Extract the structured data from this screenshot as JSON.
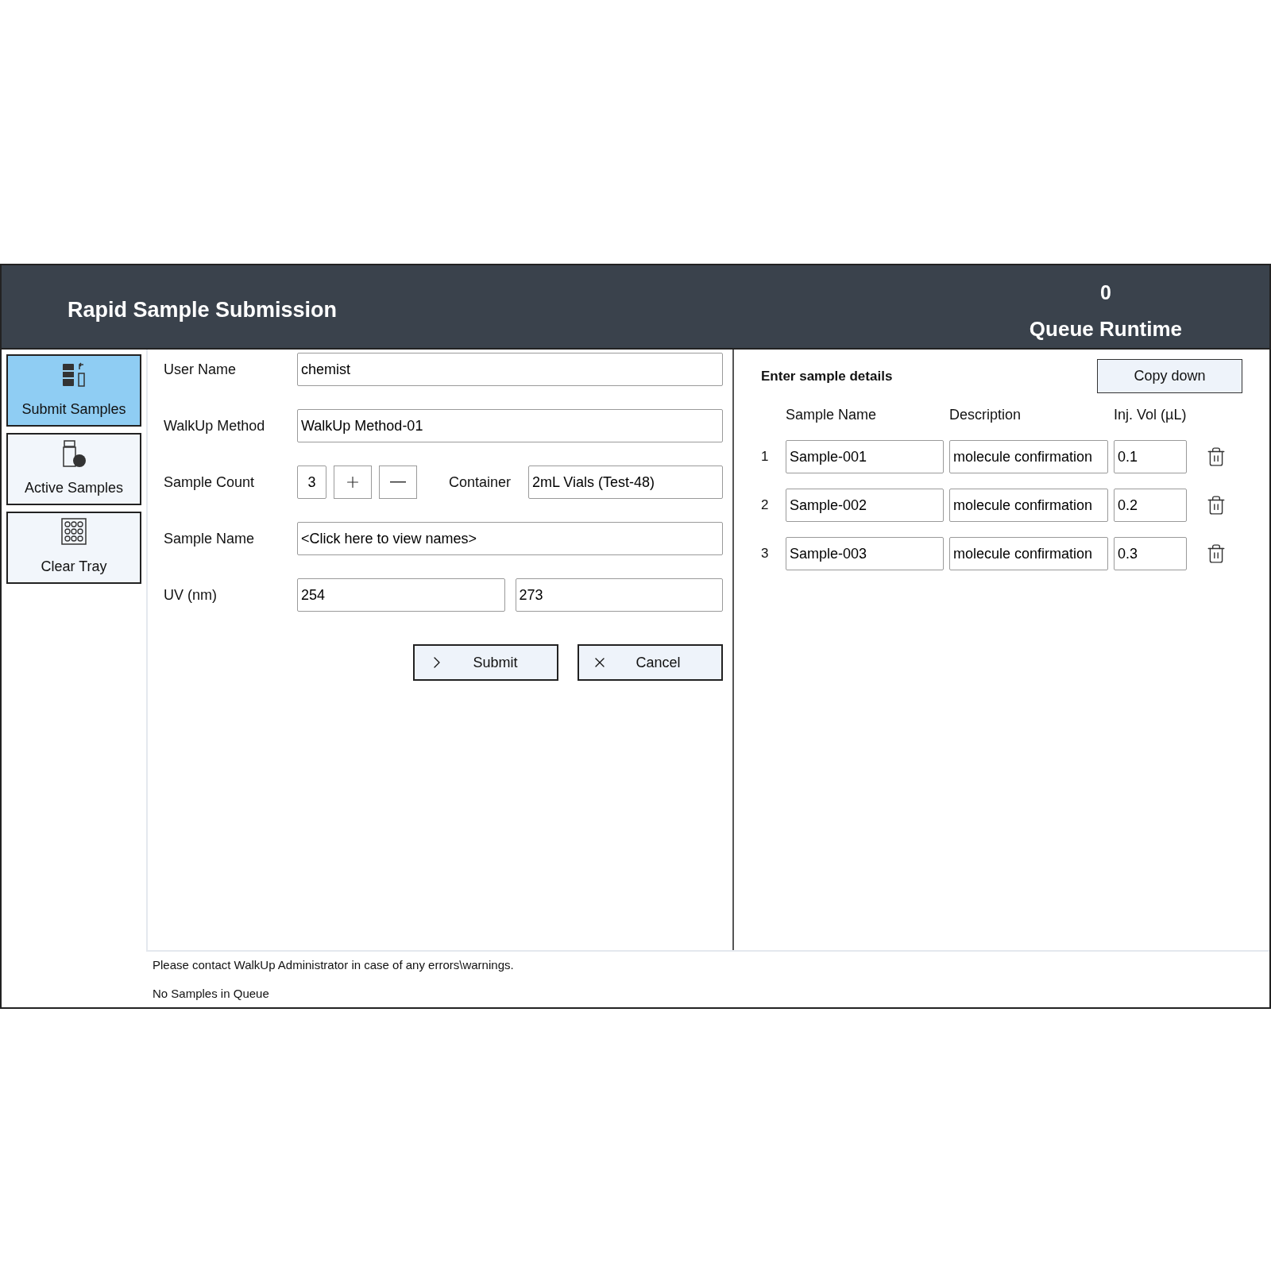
{
  "header": {
    "title": "Rapid Sample Submission",
    "queue_count": "0",
    "queue_label": "Queue Runtime"
  },
  "sidebar": {
    "items": [
      {
        "label": "Submit Samples",
        "selected": true,
        "kind": "bottles"
      },
      {
        "label": "Active Samples",
        "selected": false,
        "kind": "vial"
      },
      {
        "label": "Clear Tray",
        "selected": false,
        "kind": "tray"
      }
    ]
  },
  "form": {
    "user_name": {
      "label": "User Name",
      "value": "chemist"
    },
    "method": {
      "label": "WalkUp Method",
      "value": "WalkUp Method-01"
    },
    "sample_count": {
      "label": "Sample Count",
      "value": "3"
    },
    "container": {
      "label": "Container",
      "value": "2mL Vials (Test-48)"
    },
    "sample_name": {
      "label": "Sample Name",
      "value": "<Click here to view names>"
    },
    "uv": {
      "label": "UV (nm)",
      "values": [
        "254",
        "273"
      ]
    },
    "buttons": [
      {
        "label": "Submit",
        "kind": "submit"
      },
      {
        "label": "Cancel",
        "kind": "cancel"
      }
    ]
  },
  "details": {
    "title": "Enter sample details",
    "copy_button": "Copy down",
    "columns": [
      "Sample Name",
      "Description",
      "Inj. Vol (µL)"
    ],
    "rows": [
      {
        "index": "1",
        "name": "Sample-001",
        "description": "molecule confirmation",
        "volume": "0.1"
      },
      {
        "index": "2",
        "name": "Sample-002",
        "description": "molecule confirmation",
        "volume": "0.2"
      },
      {
        "index": "3",
        "name": "Sample-003",
        "description": "molecule confirmation",
        "volume": "0.3"
      }
    ]
  },
  "status_bar": [
    "Please contact WalkUp Administrator in case of any errors\\warnings.",
    "No Samples in Queue"
  ]
}
